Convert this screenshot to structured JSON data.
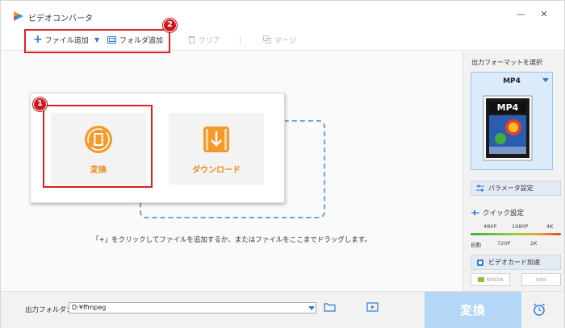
{
  "window": {
    "title": "ビデオコンバータ"
  },
  "toolbar": {
    "add_file_label": "ファイル追加",
    "add_folder_label": "フォルダ追加",
    "clear_label": "クリア",
    "merge_label": "マージ"
  },
  "annotations": {
    "badge_toolbar": "2",
    "badge_convert": "1"
  },
  "main": {
    "convert_tile_label": "変換",
    "download_tile_label": "ダウンロード",
    "instruction": "「+」をクリックしてファイルを追加するか、またはファイルをここまでドラッグします。"
  },
  "right_panel": {
    "output_format_title": "出力フォーマットを選択",
    "format_name": "MP4",
    "format_badge": "MP4",
    "param_button_label": "パラメータ設定",
    "quick_settings_label": "クイック設定",
    "ticks_top": [
      "480P",
      "1080P",
      "4K"
    ],
    "ticks_bottom": [
      "自動",
      "720P",
      "2K"
    ],
    "gpu_button_label": "ビデオカード加速",
    "chip_nvidia": "NVIDIA",
    "chip_intel": "Intel"
  },
  "bottom": {
    "output_folder_label": "出力フォルダ：",
    "output_folder_value": "D:¥ffmpeg",
    "convert_button_label": "変換"
  },
  "colors": {
    "accent": "#2a7ad6",
    "orange": "#f08a1c",
    "highlight": "#e01f1f",
    "convert_disabled": "#b4d6f7"
  }
}
